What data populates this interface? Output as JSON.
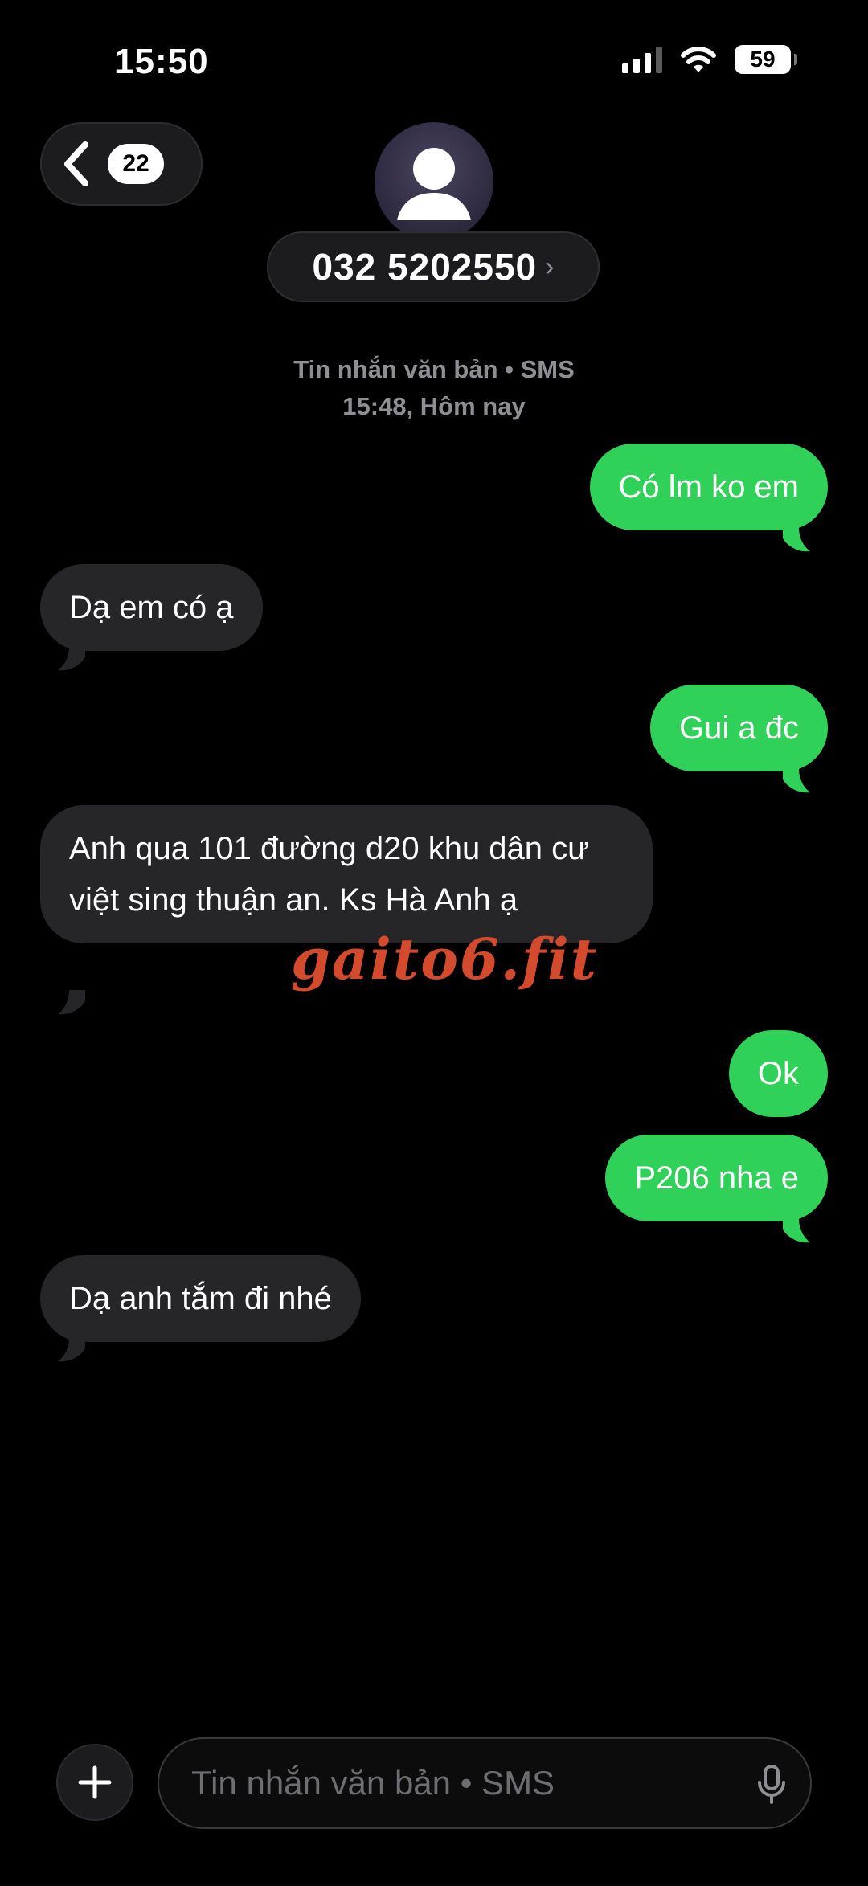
{
  "status": {
    "time": "15:50",
    "battery": "59"
  },
  "header": {
    "back_badge": "22",
    "contact_name": "032 5202550",
    "chevron": "›"
  },
  "meta": {
    "line1": "Tin nhắn văn bản • SMS",
    "line2": "15:48, Hôm nay"
  },
  "messages": [
    {
      "direction": "sent",
      "text": "Có lm ko em"
    },
    {
      "direction": "received",
      "text": "Dạ em có ạ"
    },
    {
      "direction": "sent",
      "text": "Gui a đc"
    },
    {
      "direction": "received",
      "text": "Anh qua 101 đường d20 khu dân cư việt sing thuận an. Ks Hà Anh ạ"
    },
    {
      "direction": "sent",
      "text": "Ok"
    },
    {
      "direction": "sent",
      "text": "P206 nha e"
    },
    {
      "direction": "received",
      "text": "Dạ anh tắm đi nhé"
    }
  ],
  "watermark": "gaito6.fit",
  "composer": {
    "placeholder": "Tin nhắn văn bản • SMS"
  },
  "icons": {
    "back": "chevron-left-icon",
    "avatar": "person-icon",
    "plus": "plus-icon",
    "mic": "microphone-icon",
    "signal": "cellular-signal-icon",
    "wifi": "wifi-icon",
    "battery": "battery-icon"
  },
  "colors": {
    "sent_bubble": "#30d158",
    "received_bubble": "#262628",
    "background": "#000000",
    "watermark": "#d44a2c"
  }
}
